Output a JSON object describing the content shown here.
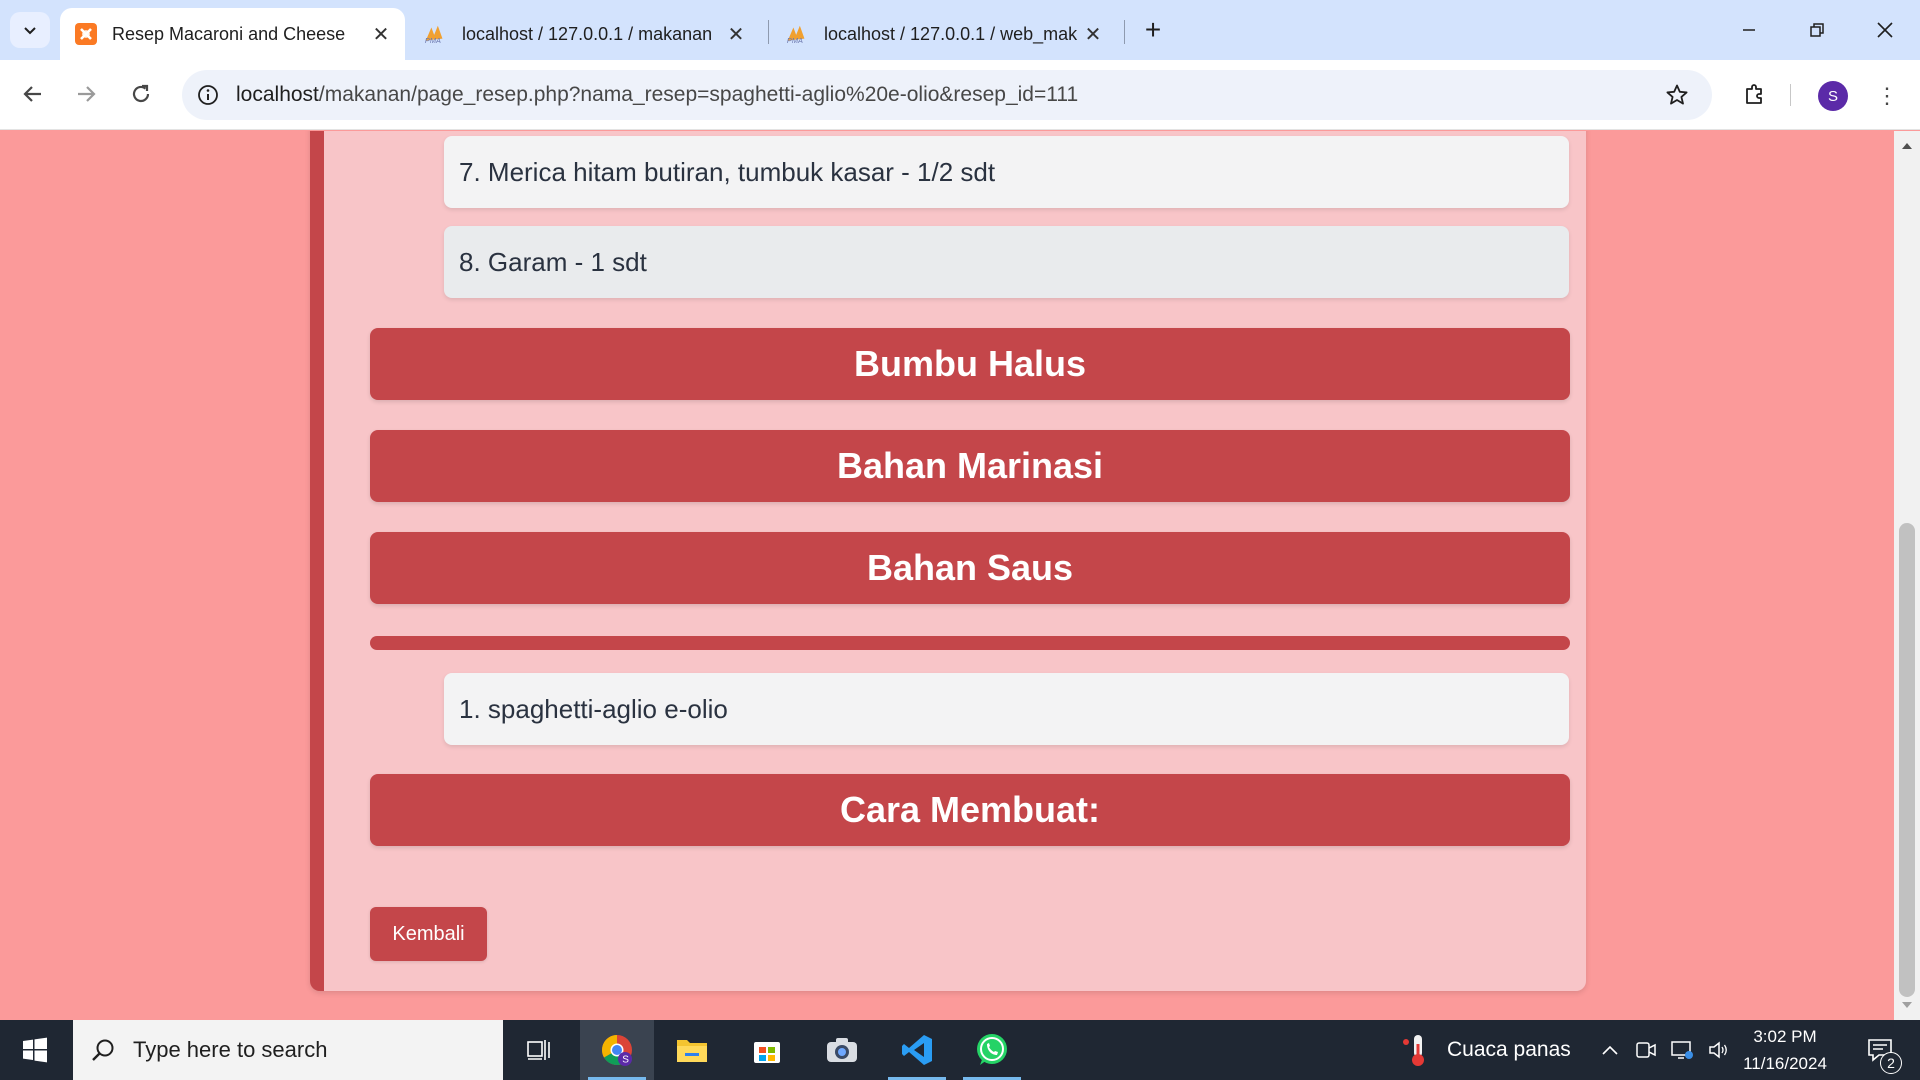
{
  "browser": {
    "tabs": [
      {
        "title": "Resep Macaroni and Cheese",
        "active": true,
        "icon": "xampp-icon"
      },
      {
        "title": "localhost / 127.0.0.1 / makanan",
        "active": false,
        "icon": "phpmyadmin-icon"
      },
      {
        "title": "localhost / 127.0.0.1 / web_mak",
        "active": false,
        "icon": "phpmyadmin-icon"
      }
    ],
    "url_host": "localhost",
    "url_path": "/makanan/page_resep.php?nama_resep=spaghetti-aglio%20e-olio&resep_id=111",
    "profile_initial": "S"
  },
  "page": {
    "ingredients_top": [
      "7. Merica hitam butiran, tumbuk kasar - 1/2 sdt",
      "8. Garam - 1 sdt"
    ],
    "sections": {
      "bumbu_halus": "Bumbu Halus",
      "bahan_marinasi": "Bahan Marinasi",
      "bahan_saus": "Bahan Saus",
      "cara_membuat": "Cara Membuat:"
    },
    "extra_items": [
      "1. spaghetti-aglio e-olio"
    ],
    "back_button": "Kembali"
  },
  "taskbar": {
    "search_placeholder": "Type here to search",
    "weather": "Cuaca panas",
    "time": "3:02 PM",
    "date": "11/16/2024",
    "notification_count": "2"
  },
  "colors": {
    "page_bg": "#fb9a9a",
    "card_bg": "#f8c5c8",
    "accent": "#c4464a",
    "tabbar": "#d3e3fd",
    "taskbar": "#1f2733"
  }
}
